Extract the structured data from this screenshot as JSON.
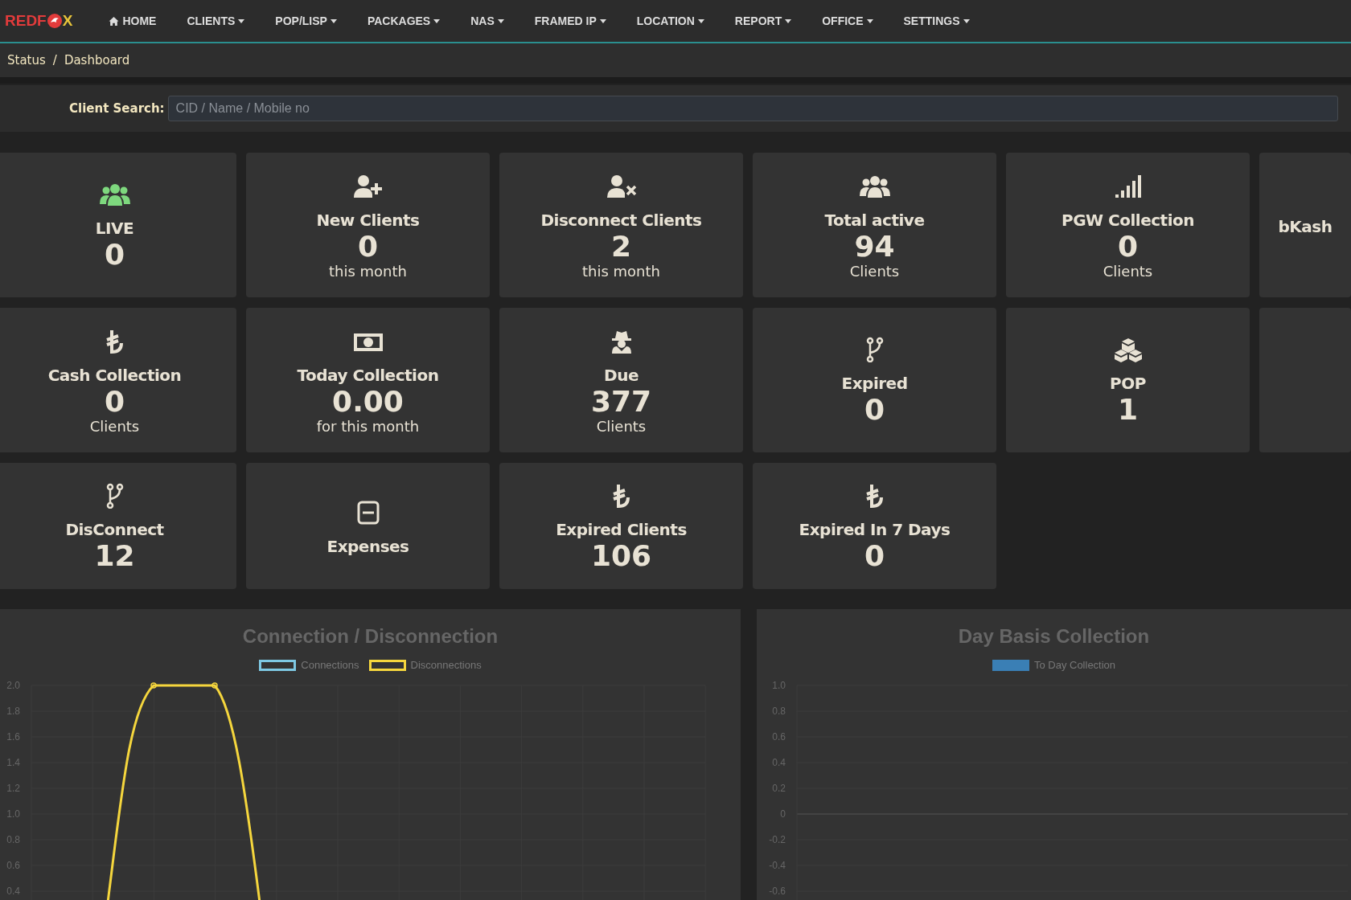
{
  "logo": {
    "left": "REDF",
    "right": "X"
  },
  "nav": [
    {
      "label": "HOME",
      "dropdown": false
    },
    {
      "label": "CLIENTS",
      "dropdown": true
    },
    {
      "label": "POP/LISP",
      "dropdown": true
    },
    {
      "label": "PACKAGES",
      "dropdown": true
    },
    {
      "label": "NAS",
      "dropdown": true
    },
    {
      "label": "FRAMED IP",
      "dropdown": true
    },
    {
      "label": "LOCATION",
      "dropdown": true
    },
    {
      "label": "REPORT",
      "dropdown": true
    },
    {
      "label": "OFFICE",
      "dropdown": true
    },
    {
      "label": "SETTINGS",
      "dropdown": true
    }
  ],
  "breadcrumb": [
    "Status",
    "/",
    "Dashboard"
  ],
  "search": {
    "label": "Client Search:",
    "placeholder": "CID / Name / Mobile no"
  },
  "cards": [
    {
      "kind": "stat",
      "color": "#7ed87e",
      "title": "LIVE",
      "value": "0"
    },
    {
      "kind": "stat",
      "title": "New Clients",
      "value": "0",
      "sub": "this month"
    },
    {
      "kind": "stat",
      "title": "Disconnect Clients",
      "value": "2",
      "sub": "this month"
    },
    {
      "kind": "stat",
      "title": "Total active",
      "value": "94",
      "sub": "Clients"
    },
    {
      "kind": "stat",
      "title": "PGW Collection",
      "value": "0",
      "sub": "Clients"
    },
    {
      "kind": "stat",
      "title": "bKash"
    },
    {
      "kind": "stat",
      "title": "Cash Collection",
      "value": "0",
      "sub": "Clients"
    },
    {
      "kind": "stat",
      "title": "Today Collection",
      "value": "0.00",
      "sub": "for this month"
    },
    {
      "kind": "stat",
      "title": "Due",
      "value": "377",
      "sub": "Clients"
    },
    {
      "kind": "stat",
      "title": "Expired",
      "value": "0"
    },
    {
      "kind": "stat",
      "title": "POP",
      "value": "1"
    },
    {
      "kind": "blank"
    },
    {
      "kind": "stat",
      "title": "DisConnect",
      "value": "12"
    },
    {
      "kind": "stat",
      "title": "Expenses"
    },
    {
      "kind": "stat",
      "title": "Expired Clients",
      "value": "106"
    },
    {
      "kind": "stat",
      "title": "Expired In 7 Days",
      "value": "0"
    }
  ],
  "charts": [
    {
      "title": "Connection / Disconnection",
      "axis_labels": [
        "2.0",
        "1.8",
        "1.6",
        "1.4",
        "1.2",
        "1.0",
        "0.8",
        "0.6",
        "0.4"
      ],
      "legend": [
        {
          "name": "Connections",
          "color": "#7ec8e3"
        },
        {
          "name": "Disconnections",
          "color": "#f5d63d"
        }
      ]
    },
    {
      "chart_data": {
        "type": "bar",
        "title": "Day Basis Collection",
        "ylim": [
          -0.6,
          1
        ],
        "yticks": [
          {
            "value": 1,
            "label": "1.0"
          },
          {
            "value": 0.8,
            "label": "0.8"
          },
          {
            "value": 0.6,
            "label": "0.6"
          },
          {
            "value": 0.4,
            "label": "0.4"
          },
          {
            "value": 0.2,
            "label": "0.2"
          },
          {
            "value": 0,
            "label": "0"
          },
          {
            "value": -0.2,
            "label": "-0.2"
          },
          {
            "value": -0.4,
            "label": "-0.4"
          },
          {
            "value": -0.6,
            "label": "-0.6"
          }
        ],
        "series": [
          {
            "name": "To Day Collection",
            "color": "#3a7fb5"
          }
        ]
      }
    }
  ]
}
